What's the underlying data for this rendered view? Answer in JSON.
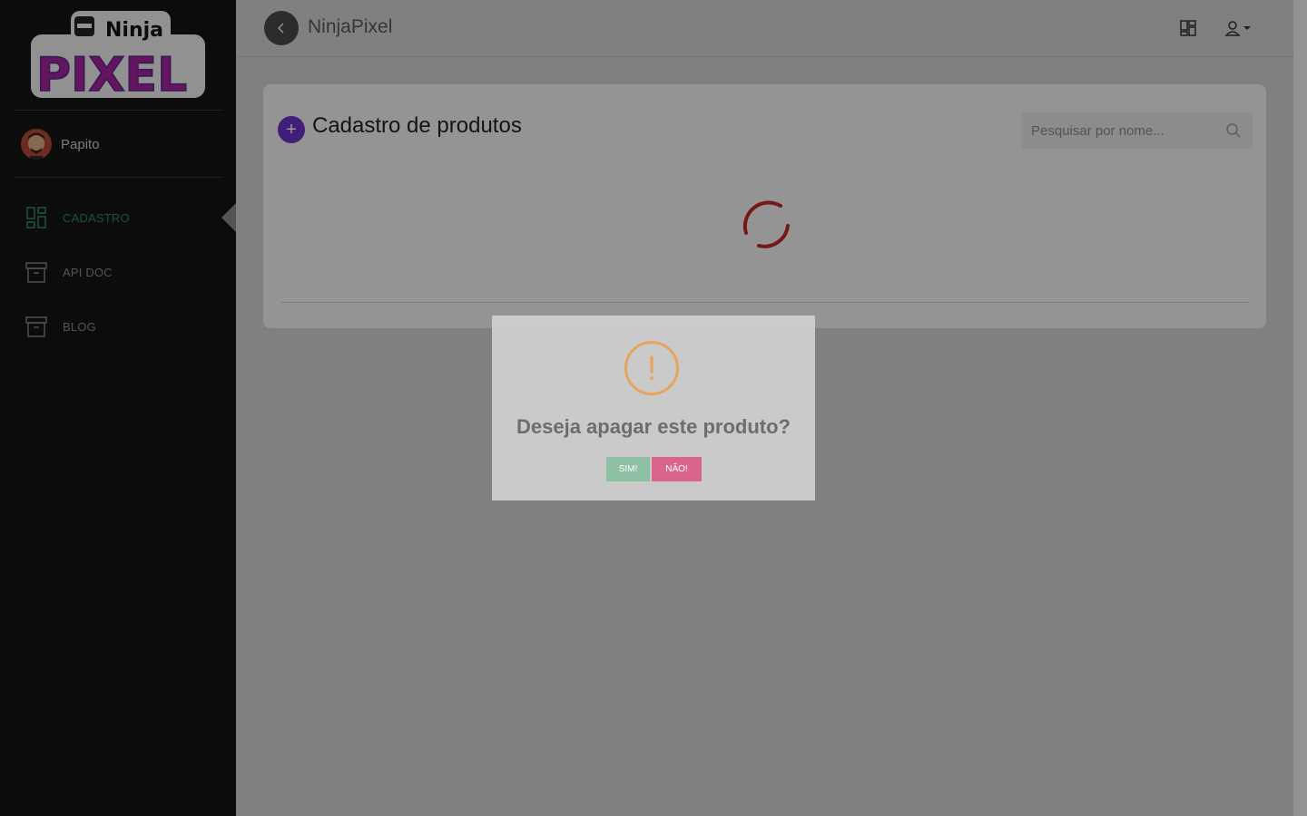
{
  "app": {
    "logo_text_top": "Ninja",
    "logo_text_bottom": "PIXEL",
    "brand": "NinjaPixel"
  },
  "user": {
    "name": "Papito"
  },
  "sidebar": {
    "items": [
      {
        "label": "CADASTRO",
        "icon": "dashboard-icon",
        "active": true
      },
      {
        "label": "API DOC",
        "icon": "archive-icon",
        "active": false
      },
      {
        "label": "BLOG",
        "icon": "archive-icon",
        "active": false
      }
    ]
  },
  "main": {
    "title": "Cadastro de produtos",
    "add_label": "+",
    "search": {
      "placeholder": "Pesquisar por nome..."
    }
  },
  "modal": {
    "icon": "!",
    "title": "Deseja apagar este produto?",
    "confirm_label": "SIM!",
    "cancel_label": "NÃO!"
  },
  "colors": {
    "active_menu": "#2e8a5f",
    "add_button": "#6e33c9",
    "spinner": "#c62828",
    "warning": "#e6a55e",
    "confirm": "#8ec1a3",
    "cancel": "#d9658b"
  }
}
